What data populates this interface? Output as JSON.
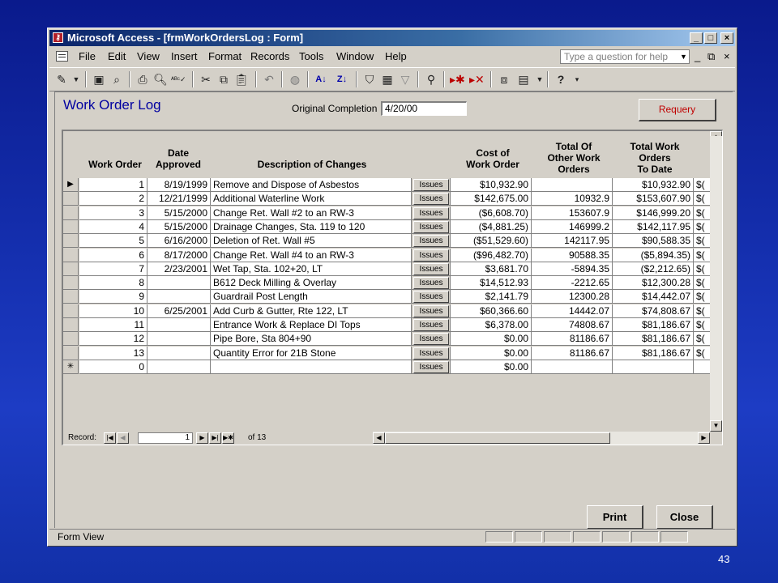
{
  "window": {
    "title": "Microsoft Access - [frmWorkOrdersLog : Form]",
    "app_icon": "access-key-icon",
    "controls": [
      "_",
      "□",
      "×"
    ]
  },
  "menu": {
    "items": [
      "File",
      "Edit",
      "View",
      "Insert",
      "Format",
      "Records",
      "Tools",
      "Window",
      "Help"
    ],
    "help_placeholder": "Type a question for help",
    "mdi_controls": [
      "_",
      "⧉",
      "×"
    ]
  },
  "toolbar": {
    "icons": [
      "design-view-icon",
      "save-icon",
      "search-file-icon",
      "print-icon",
      "print-preview-icon",
      "spelling-icon",
      "cut-icon",
      "copy-icon",
      "paste-icon",
      "undo-icon",
      "hyperlink-icon",
      "sort-ascending-icon",
      "sort-descending-icon",
      "filter-by-selection-icon",
      "filter-by-form-icon",
      "apply-filter-icon",
      "find-icon",
      "new-record-icon",
      "delete-record-icon",
      "database-window-icon",
      "new-object-icon",
      "help-icon"
    ]
  },
  "form": {
    "title": "Work Order Log",
    "original_completion_label": "Original Completion",
    "original_completion_value": "4/20/00",
    "requery_label": "Requery",
    "print_label": "Print",
    "close_label": "Close"
  },
  "table": {
    "headers": {
      "work_order": "Work Order",
      "date_approved": "Date\nApproved",
      "description": "Description of Changes",
      "cost": "Cost of\nWork Order",
      "total_other": "Total Of\nOther Work\nOrders",
      "total_to_date": "Total Work\nOrders\nTo Date"
    },
    "issues_label": "Issues",
    "rows": [
      {
        "wo": "1",
        "date": "8/19/1999",
        "desc": "Remove and Dispose of Asbestos",
        "cost": "$10,932.90",
        "other": "",
        "todate": "$10,932.90",
        "marker": "▶"
      },
      {
        "wo": "2",
        "date": "12/21/1999",
        "desc": "Additional Waterline Work",
        "cost": "$142,675.00",
        "other": "10932.9",
        "todate": "$153,607.90",
        "marker": ""
      },
      {
        "wo": "3",
        "date": "5/15/2000",
        "desc": "Change Ret. Wall #2 to an RW-3",
        "cost": "($6,608.70)",
        "other": "153607.9",
        "todate": "$146,999.20",
        "marker": ""
      },
      {
        "wo": "4",
        "date": "5/15/2000",
        "desc": "Drainage Changes, Sta. 119 to 120",
        "cost": "($4,881.25)",
        "other": "146999.2",
        "todate": "$142,117.95",
        "marker": ""
      },
      {
        "wo": "5",
        "date": "6/16/2000",
        "desc": "Deletion of Ret. Wall #5",
        "cost": "($51,529.60)",
        "other": "142117.95",
        "todate": "$90,588.35",
        "marker": ""
      },
      {
        "wo": "6",
        "date": "8/17/2000",
        "desc": "Change Ret. Wall #4 to an RW-3",
        "cost": "($96,482.70)",
        "other": "90588.35",
        "todate": "($5,894.35)",
        "marker": ""
      },
      {
        "wo": "7",
        "date": "2/23/2001",
        "desc": "Wet Tap, Sta. 102+20, LT",
        "cost": "$3,681.70",
        "other": "-5894.35",
        "todate": "($2,212.65)",
        "marker": ""
      },
      {
        "wo": "8",
        "date": "",
        "desc": "B612 Deck Milling & Overlay",
        "cost": "$14,512.93",
        "other": "-2212.65",
        "todate": "$12,300.28",
        "marker": ""
      },
      {
        "wo": "9",
        "date": "",
        "desc": "Guardrail Post Length",
        "cost": "$2,141.79",
        "other": "12300.28",
        "todate": "$14,442.07",
        "marker": ""
      },
      {
        "wo": "10",
        "date": "6/25/2001",
        "desc": "Add Curb & Gutter, Rte 122, LT",
        "cost": "$60,366.60",
        "other": "14442.07",
        "todate": "$74,808.67",
        "marker": ""
      },
      {
        "wo": "11",
        "date": "",
        "desc": "Entrance Work & Replace DI Tops",
        "cost": "$6,378.00",
        "other": "74808.67",
        "todate": "$81,186.67",
        "marker": ""
      },
      {
        "wo": "12",
        "date": "",
        "desc": "Pipe Bore, Sta 804+90",
        "cost": "$0.00",
        "other": "81186.67",
        "todate": "$81,186.67",
        "marker": ""
      },
      {
        "wo": "13",
        "date": "",
        "desc": "Quantity Error for 21B Stone",
        "cost": "$0.00",
        "other": "81186.67",
        "todate": "$81,186.67",
        "marker": ""
      },
      {
        "wo": "0",
        "date": "",
        "desc": "",
        "cost": "$0.00",
        "other": "",
        "todate": "",
        "marker": "✳"
      }
    ],
    "overflow_cell": "$("
  },
  "navigation": {
    "label": "Record:",
    "current": "1",
    "of_text": "of  13"
  },
  "status": {
    "text": "Form View"
  },
  "slide_number": "43"
}
